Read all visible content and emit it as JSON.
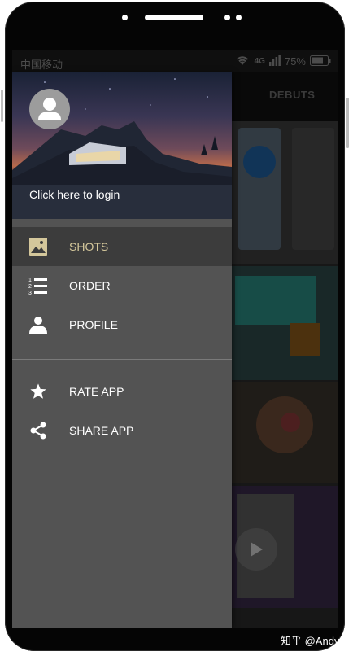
{
  "status_bar": {
    "carrier": "中国移动",
    "network": "4G",
    "battery": "75%",
    "battery_level": 0.75
  },
  "app_bar": {
    "tab_label": "DEBUTS"
  },
  "drawer": {
    "login_text": "Click here to login",
    "items": [
      {
        "label": "SHOTS",
        "icon": "image-icon",
        "active": true
      },
      {
        "label": "ORDER",
        "icon": "numbered-list-icon",
        "active": false
      },
      {
        "label": "PROFILE",
        "icon": "person-icon",
        "active": false
      },
      {
        "label": "RATE APP",
        "icon": "star-icon",
        "active": false
      },
      {
        "label": "SHARE APP",
        "icon": "share-icon",
        "active": false
      }
    ]
  },
  "watermark": "知乎 @Andy",
  "colors": {
    "active_label": "#d4c79b",
    "drawer_bg": "#535353",
    "active_row_bg": "#3c3c3c"
  }
}
